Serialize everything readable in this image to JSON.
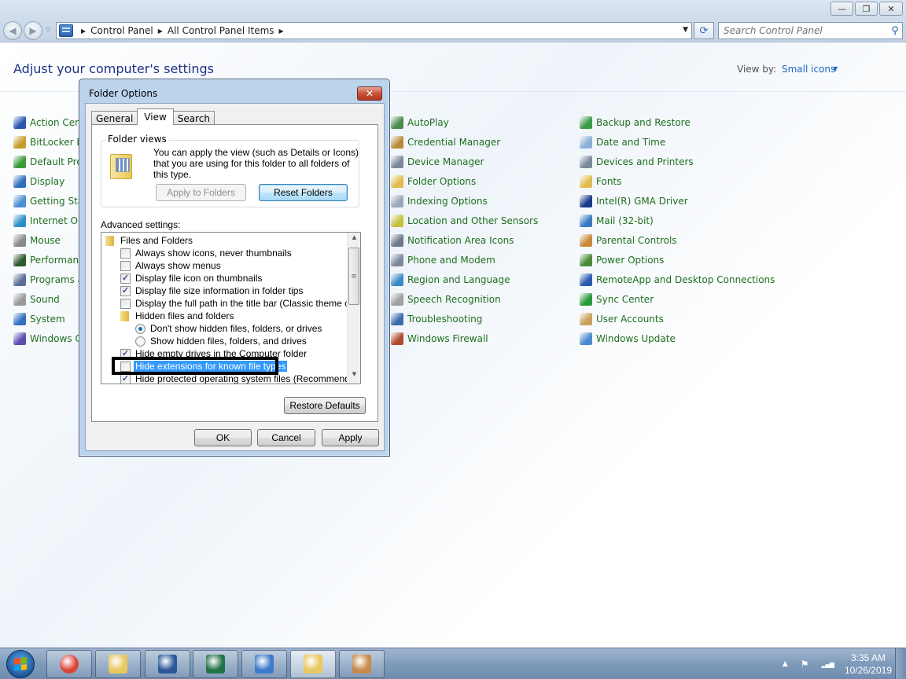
{
  "window": {
    "controls": {
      "minimize": "—",
      "maximize": "❐",
      "close": "✕"
    }
  },
  "navbar": {
    "back_icon": "◀",
    "forward_icon": "▶",
    "recent_icon": "▽",
    "breadcrumbs": [
      "Control Panel",
      "All Control Panel Items"
    ],
    "crumb_separator": "▶",
    "dropdown_icon": "▼",
    "refresh_icon": "⟳",
    "search_placeholder": "Search Control Panel",
    "search_icon": "⚲"
  },
  "content": {
    "title": "Adjust your computer's settings",
    "view_by_label": "View by:",
    "view_by_value": "Small icons",
    "view_by_caret": "▼",
    "columns": [
      [
        {
          "label": "Action Center",
          "color": "#2a55b0"
        },
        {
          "label": "BitLocker Drive Encryption",
          "color": "#c89b2a"
        },
        {
          "label": "Default Programs",
          "color": "#3a9b3a"
        },
        {
          "label": "Display",
          "color": "#2f6fc0"
        },
        {
          "label": "Getting Started",
          "color": "#4a8fd0"
        },
        {
          "label": "Internet Options",
          "color": "#2e8fc8"
        },
        {
          "label": "Mouse",
          "color": "#8a8a8a"
        },
        {
          "label": "Performance Information and Tools",
          "color": "#2c5a2c"
        },
        {
          "label": "Programs and Features",
          "color": "#5a6f9a"
        },
        {
          "label": "Sound",
          "color": "#9a9a9a"
        },
        {
          "label": "System",
          "color": "#3470c0"
        },
        {
          "label": "Windows CardSpace",
          "color": "#5a4fb0"
        }
      ],
      [
        {
          "label": "AutoPlay",
          "color": "#4a8a4a"
        },
        {
          "label": "Credential Manager",
          "color": "#b88a3a"
        },
        {
          "label": "Device Manager",
          "color": "#7a8a9a"
        },
        {
          "label": "Folder Options",
          "color": "#e0bc50"
        },
        {
          "label": "Indexing Options",
          "color": "#9aa8b8"
        },
        {
          "label": "Location and Other Sensors",
          "color": "#c8c040"
        },
        {
          "label": "Notification Area Icons",
          "color": "#6a7a8a"
        },
        {
          "label": "Phone and Modem",
          "color": "#7a8a9a"
        },
        {
          "label": "Region and Language",
          "color": "#3a8ac8"
        },
        {
          "label": "Speech Recognition",
          "color": "#a0a0a0"
        },
        {
          "label": "Troubleshooting",
          "color": "#3a6ab0"
        },
        {
          "label": "Windows Firewall",
          "color": "#b04a2a"
        }
      ],
      [
        {
          "label": "Backup and Restore",
          "color": "#3a9a4a"
        },
        {
          "label": "Date and Time",
          "color": "#8ab0d8"
        },
        {
          "label": "Devices and Printers",
          "color": "#7a8a9a"
        },
        {
          "label": "Fonts",
          "color": "#e0bc50"
        },
        {
          "label": "Intel(R) GMA Driver",
          "color": "#1a3a8a"
        },
        {
          "label": "Mail (32-bit)",
          "color": "#3a7ac0"
        },
        {
          "label": "Parental Controls",
          "color": "#c88a3a"
        },
        {
          "label": "Power Options",
          "color": "#4a8a3a"
        },
        {
          "label": "RemoteApp and Desktop Connections",
          "color": "#2a5ab0"
        },
        {
          "label": "Sync Center",
          "color": "#2a9a3a"
        },
        {
          "label": "User Accounts",
          "color": "#c8a05a"
        },
        {
          "label": "Windows Update",
          "color": "#4a8ad0"
        }
      ]
    ]
  },
  "dialog": {
    "title": "Folder Options",
    "close_icon": "✕",
    "tabs": [
      "General",
      "View",
      "Search"
    ],
    "active_tab": "View",
    "folder_views": {
      "legend": "Folder views",
      "description": "You can apply the view (such as Details or Icons) that you are using for this folder to all folders of this type.",
      "apply_button": "Apply to Folders",
      "reset_button": "Reset Folders"
    },
    "advanced_label": "Advanced settings:",
    "tree": [
      {
        "type": "folder",
        "indent": 0,
        "label": "Files and Folders"
      },
      {
        "type": "checkbox",
        "indent": 1,
        "label": "Always show icons, never thumbnails",
        "checked": false
      },
      {
        "type": "checkbox",
        "indent": 1,
        "label": "Always show menus",
        "checked": false
      },
      {
        "type": "checkbox",
        "indent": 1,
        "label": "Display file icon on thumbnails",
        "checked": true
      },
      {
        "type": "checkbox",
        "indent": 1,
        "label": "Display file size information in folder tips",
        "checked": true
      },
      {
        "type": "checkbox",
        "indent": 1,
        "label": "Display the full path in the title bar (Classic theme only)",
        "checked": false
      },
      {
        "type": "folder",
        "indent": 1,
        "label": "Hidden files and folders"
      },
      {
        "type": "radio",
        "indent": 2,
        "label": "Don't show hidden files, folders, or drives",
        "checked": true
      },
      {
        "type": "radio",
        "indent": 2,
        "label": "Show hidden files, folders, and drives",
        "checked": false
      },
      {
        "type": "checkbox",
        "indent": 1,
        "label": "Hide empty drives in the Computer folder",
        "checked": true
      },
      {
        "type": "checkbox",
        "indent": 1,
        "label": "Hide extensions for known file types",
        "checked": false,
        "selected": true
      },
      {
        "type": "checkbox",
        "indent": 1,
        "label": "Hide protected operating system files (Recommended)",
        "checked": true
      }
    ],
    "check_glyph": "✓",
    "scroll_up": "▲",
    "scroll_down": "▼",
    "scroll_grip": "≡",
    "restore_defaults": "Restore Defaults",
    "ok": "OK",
    "cancel": "Cancel",
    "apply": "Apply"
  },
  "taskbar": {
    "apps": [
      {
        "name": "chrome",
        "color": "#db4437",
        "active": false
      },
      {
        "name": "windows-explorer",
        "color": "#e8c860",
        "active": false
      },
      {
        "name": "word",
        "color": "#2b579a",
        "active": false
      },
      {
        "name": "excel",
        "color": "#217346",
        "active": false
      },
      {
        "name": "control-panel",
        "color": "#3a7ac8",
        "active": false
      },
      {
        "name": "folder-options",
        "color": "#e8c860",
        "active": true
      },
      {
        "name": "paint",
        "color": "#c88a4a",
        "active": false
      }
    ],
    "tray": {
      "show_hidden_icon": "▲",
      "action_center_icon": "⚑",
      "network_icon": "▂▄▆",
      "time": "3:35 AM",
      "date": "10/26/2019"
    }
  }
}
